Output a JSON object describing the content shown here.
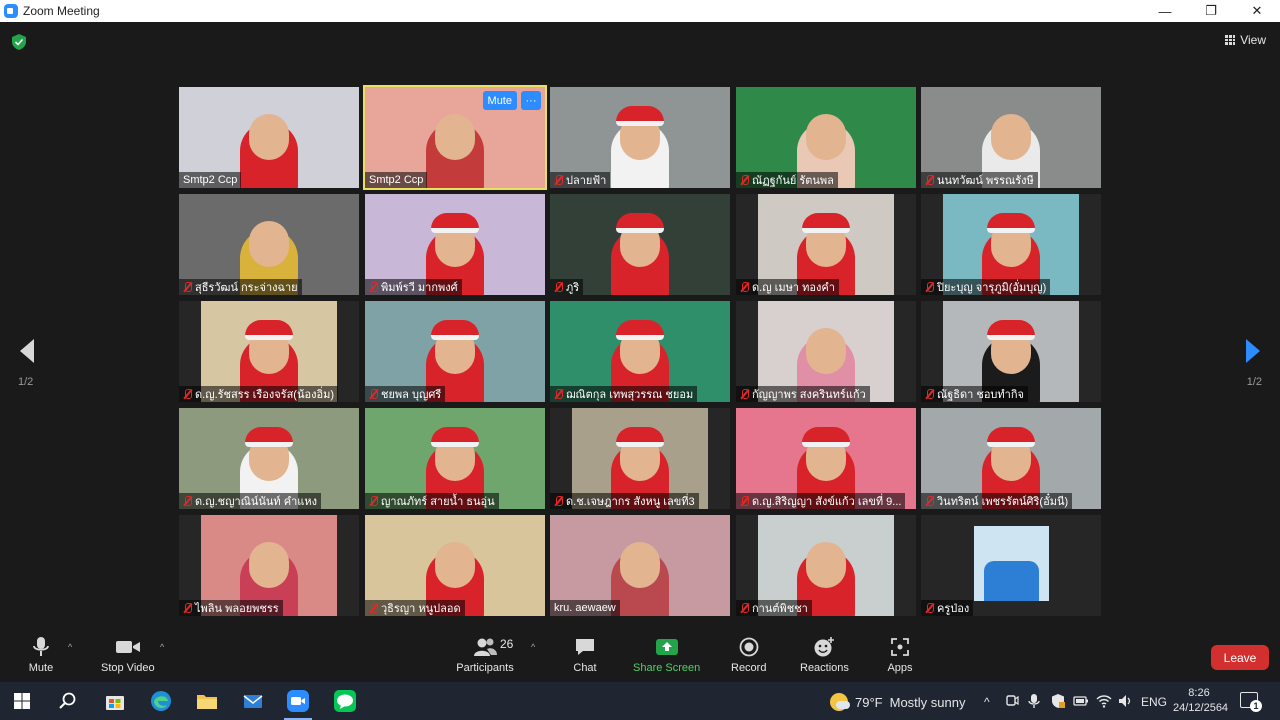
{
  "window": {
    "title": "Zoom Meeting",
    "controls": [
      "—",
      "❐",
      "✕"
    ]
  },
  "meeting": {
    "view_label": "View",
    "page_indicator_left": "1/2",
    "page_indicator_right": "1/2",
    "tile_controls": {
      "mute_label": "Mute",
      "more_label": "···"
    }
  },
  "participants": [
    {
      "name": "Smtp2 Ccp",
      "muted": false,
      "bg": "#d0d0d8",
      "shirt": "#d8232a",
      "hat": false,
      "narrow": false
    },
    {
      "name": "Smtp2 Ccp",
      "muted": false,
      "bg": "#e8a59a",
      "shirt": "#c43b3b",
      "hat": false,
      "narrow": false,
      "active": true
    },
    {
      "name": "ปลายฟ้า",
      "muted": true,
      "bg": "#8f9595",
      "shirt": "#f2f2f2",
      "hat": true,
      "narrow": false
    },
    {
      "name": "ณัฏฐกันย์ รัตนพล",
      "muted": true,
      "bg": "#2f8a4a",
      "shirt": "#e9c9b6",
      "hat": false,
      "narrow": false
    },
    {
      "name": "นนทวัฒน์ พรรณรังษี",
      "muted": true,
      "bg": "#8a8c8c",
      "shirt": "#eaeaea",
      "hat": false,
      "narrow": false
    },
    {
      "name": "สุธีรวัฒน์ กระจ่างฉาย",
      "muted": true,
      "bg": "#6b6b6b",
      "shirt": "#d8b23a",
      "hat": false,
      "narrow": false
    },
    {
      "name": "พิมพ์รวี มากพงศ์",
      "muted": true,
      "bg": "#c8b7d6",
      "shirt": "#d8232a",
      "hat": true,
      "narrow": false
    },
    {
      "name": "ภูริ",
      "muted": true,
      "bg": "#334038",
      "shirt": "#d8232a",
      "hat": true,
      "narrow": false
    },
    {
      "name": "ด.ญ เมษา ทองคำ",
      "muted": true,
      "bg": "#cfc9c3",
      "shirt": "#d8232a",
      "hat": true,
      "narrow": true
    },
    {
      "name": "ปิยะบุญ จารุภูมิ(อั่มบุญ)",
      "muted": true,
      "bg": "#7ab9c2",
      "shirt": "#d8232a",
      "hat": true,
      "narrow": true
    },
    {
      "name": "ด.ญ.รัชสรร เรืองจรัส(น้องอิ่ม)",
      "muted": true,
      "bg": "#d6c6a2",
      "shirt": "#d8232a",
      "hat": true,
      "narrow": true
    },
    {
      "name": "ชยพล บุญศรี",
      "muted": true,
      "bg": "#7fa2a6",
      "shirt": "#d8232a",
      "hat": true,
      "narrow": false
    },
    {
      "name": "ฌณิตกุล เทพสุวรรณ ชยอม",
      "muted": true,
      "bg": "#2f8f6a",
      "shirt": "#d8232a",
      "hat": true,
      "narrow": false
    },
    {
      "name": "กัญญาพร สงครินทร์แก้ว",
      "muted": true,
      "bg": "#d8cfcf",
      "shirt": "#e08fa6",
      "hat": false,
      "narrow": true
    },
    {
      "name": "ณัฐธิดา ชอบทำกิจ",
      "muted": true,
      "bg": "#b5b8ba",
      "shirt": "#1b1b1b",
      "hat": true,
      "narrow": true
    },
    {
      "name": "ด.ญ.ชญาณิน์นันท์ คำแหง",
      "muted": true,
      "bg": "#8e9a7e",
      "shirt": "#f2f2f2",
      "hat": true,
      "narrow": false
    },
    {
      "name": "ญาณภัทร์ สายน้ำ ธนอุ่น",
      "muted": true,
      "bg": "#6ea66e",
      "shirt": "#d8232a",
      "hat": true,
      "narrow": false
    },
    {
      "name": "ด.ช.เจษฎากร สังหนู เลขที่3",
      "muted": true,
      "bg": "#a8a08a",
      "shirt": "#d8232a",
      "hat": true,
      "narrow": true
    },
    {
      "name": "ด.ญ.สิริญญา สังข์แก้ว เลขที่ 9...",
      "muted": true,
      "bg": "#e5768e",
      "shirt": "#d8232a",
      "hat": true,
      "narrow": false
    },
    {
      "name": "วินทริตน์ เพชรรัตน์ศิริ(อั๋มนี)",
      "muted": true,
      "bg": "#a3a8ab",
      "shirt": "#d8232a",
      "hat": true,
      "narrow": false
    },
    {
      "name": "ไพลิน พลอยพชรร",
      "muted": true,
      "bg": "#d98a86",
      "shirt": "#c83f56",
      "hat": false,
      "narrow": true
    },
    {
      "name": "วุธิรญา หนูปลอด",
      "muted": true,
      "bg": "#d8c59c",
      "shirt": "#d8232a",
      "hat": false,
      "narrow": false
    },
    {
      "name": "kru. aewaew",
      "muted": false,
      "bg": "#c69aa0",
      "shirt": "#b9484f",
      "hat": false,
      "narrow": false
    },
    {
      "name": "กานต์พิชชา",
      "muted": true,
      "bg": "#c9cfcf",
      "shirt": "#d8232a",
      "hat": false,
      "narrow": true
    },
    {
      "name": "ครูป่อง",
      "muted": true,
      "bg": "#262626",
      "shirt": "#2d7fd6",
      "hat": false,
      "narrow": false,
      "photo": true
    }
  ],
  "toolbar": {
    "mute_label": "Mute",
    "video_label": "Stop Video",
    "participants_label": "Participants",
    "participants_count": "26",
    "chat_label": "Chat",
    "share_label": "Share Screen",
    "record_label": "Record",
    "reactions_label": "Reactions",
    "apps_label": "Apps",
    "leave_label": "Leave",
    "caret": "^"
  },
  "taskbar": {
    "weather_temp": "79°F",
    "weather_text": "Mostly sunny",
    "language": "ENG",
    "time": "8:26",
    "date": "24/12/2564",
    "notification_count": "1",
    "tray_chevron": "^"
  },
  "colors": {
    "zoom_blue": "#2d8cff",
    "share_green": "#4fd167",
    "leave_red": "#d32f2f",
    "active_speaker": "#e9e05b",
    "muted_red": "#e02828"
  }
}
